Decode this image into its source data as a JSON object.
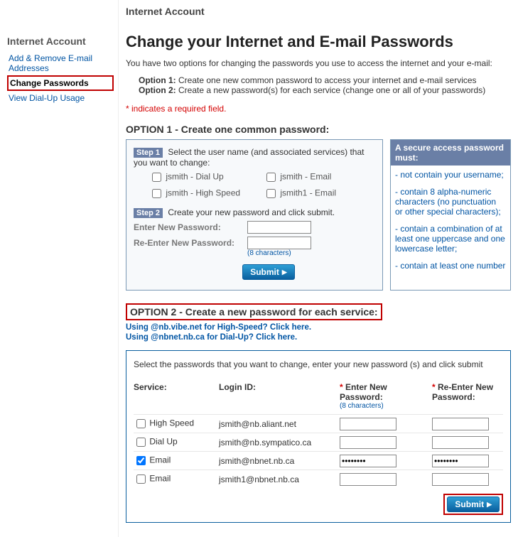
{
  "sidebar": {
    "heading": "Internet Account",
    "items": [
      {
        "label": "Add & Remove E-mail Addresses",
        "selected": false
      },
      {
        "label": "Change Passwords",
        "selected": true
      },
      {
        "label": "View Dial-Up Usage",
        "selected": false
      }
    ]
  },
  "breadcrumb": "Internet Account",
  "page_title": "Change your Internet and E-mail Passwords",
  "intro": "You have two options for changing the passwords you use to access the internet and your e-mail:",
  "options_intro": {
    "opt1_label": "Option 1:",
    "opt1_text": " Create one new common password to access your internet and e-mail services",
    "opt2_label": "Option 2:",
    "opt2_text": " Create a new password(s) for each service (change one or all of your passwords)"
  },
  "required_note": "* indicates a required field.",
  "option1": {
    "heading": "OPTION 1 - Create one common password:",
    "step1_badge": "Step 1",
    "step1_text": " Select the user name (and associated services) that you want to change:",
    "accounts": [
      {
        "label": "jsmith - Dial Up"
      },
      {
        "label": "jsmith - Email"
      },
      {
        "label": "jsmith - High Speed"
      },
      {
        "label": "jsmith1 - Email"
      }
    ],
    "step2_badge": "Step 2",
    "step2_text": " Create your new password and click submit.",
    "enter_label": "Enter New Password:",
    "reenter_label": "Re-Enter New Password:",
    "char_hint": "(8 characters)",
    "submit_label": "Submit"
  },
  "rules": {
    "heading": "A secure access password must:",
    "items": [
      "- not contain your username;",
      "- contain 8 alpha-numeric characters (no punctuation or other special characters);",
      "- contain a combination of at least one uppercase and one lowercase letter;",
      "- contain at least one number"
    ]
  },
  "option2": {
    "heading": "OPTION 2 - Create a new password for each service:",
    "link1": "Using @nb.vibe.net for High-Speed? Click here.",
    "link2": "Using @nbnet.nb.ca for Dial-Up? Click here.",
    "intro": "Select the passwords that you want to change, enter your new password (s) and click submit",
    "columns": {
      "service": "Service:",
      "login": "Login ID:",
      "pw1": "Enter New Password:",
      "pw1_hint": "(8 characters)",
      "pw2": "Re-Enter New Password:",
      "ast": "* "
    },
    "rows": [
      {
        "service": "High Speed",
        "login": "jsmith@nb.aliant.net",
        "checked": false,
        "pw1": "",
        "pw2": ""
      },
      {
        "service": "Dial Up",
        "login": "jsmith@nb.sympatico.ca",
        "checked": false,
        "pw1": "",
        "pw2": ""
      },
      {
        "service": "Email",
        "login": "jsmith@nbnet.nb.ca",
        "checked": true,
        "pw1": "••••••••",
        "pw2": "••••••••"
      },
      {
        "service": "Email",
        "login": "jsmith1@nbnet.nb.ca",
        "checked": false,
        "pw1": "",
        "pw2": ""
      }
    ],
    "submit_label": "Submit"
  }
}
